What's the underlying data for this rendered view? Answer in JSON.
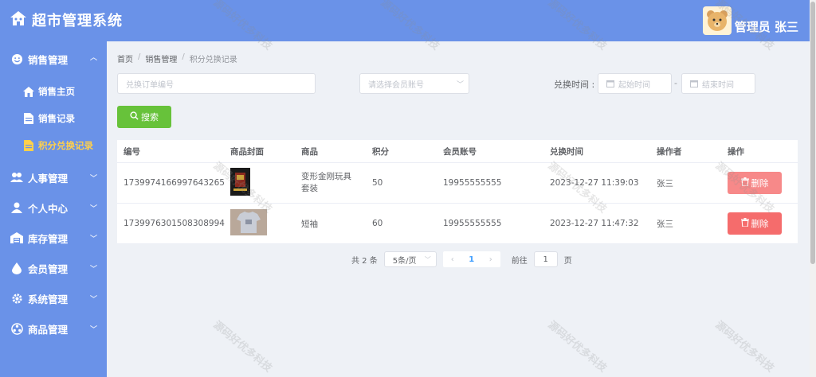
{
  "header": {
    "app_title": "超市管理系统",
    "user_label": "管理员 张三"
  },
  "sidebar": {
    "items": [
      {
        "label": "销售管理",
        "icon": "smile-icon",
        "expanded": true,
        "children": [
          {
            "label": "销售主页",
            "icon": "home-icon"
          },
          {
            "label": "销售记录",
            "icon": "document-icon"
          },
          {
            "label": "积分兑换记录",
            "icon": "document-icon",
            "active": true
          }
        ]
      },
      {
        "label": "人事管理",
        "icon": "users-icon"
      },
      {
        "label": "个人中心",
        "icon": "user-icon"
      },
      {
        "label": "库存管理",
        "icon": "warehouse-icon"
      },
      {
        "label": "会员管理",
        "icon": "drop-icon"
      },
      {
        "label": "系统管理",
        "icon": "gear-icon"
      },
      {
        "label": "商品管理",
        "icon": "box-icon"
      }
    ]
  },
  "breadcrumb": [
    "首页",
    "销售管理",
    "积分兑换记录"
  ],
  "filters": {
    "order_placeholder": "兑换订单编号",
    "member_placeholder": "请选择会员账号",
    "time_label": "兑换时间 :",
    "start_placeholder": "起始时间",
    "range_sep": "-",
    "end_placeholder": "结束时间",
    "search_label": "搜索"
  },
  "table": {
    "columns": [
      "编号",
      "商品封面",
      "商品",
      "积分",
      "会员账号",
      "兑换时间",
      "操作者",
      "操作"
    ],
    "rows": [
      {
        "id": "1739974166997643265",
        "goods": "变形金刚玩具套装",
        "points": "50",
        "member": "19955555555",
        "time": "2023-12-27 11:39:03",
        "operator": "张三",
        "action": "删除"
      },
      {
        "id": "1739976301508308994",
        "goods": "短袖",
        "points": "60",
        "member": "19955555555",
        "time": "2023-12-27 11:47:32",
        "operator": "张三",
        "action": "删除"
      }
    ]
  },
  "pagination": {
    "total": "共 2 条",
    "page_size": "5条/页",
    "current_page": "1",
    "goto_prefix": "前往",
    "goto_value": "1",
    "goto_suffix": "页"
  },
  "watermark": "源码好优多科技",
  "colors": {
    "primary": "#6a92e8",
    "success": "#67c23a",
    "danger": "#f56c6c",
    "active_menu": "#ffd04b"
  }
}
